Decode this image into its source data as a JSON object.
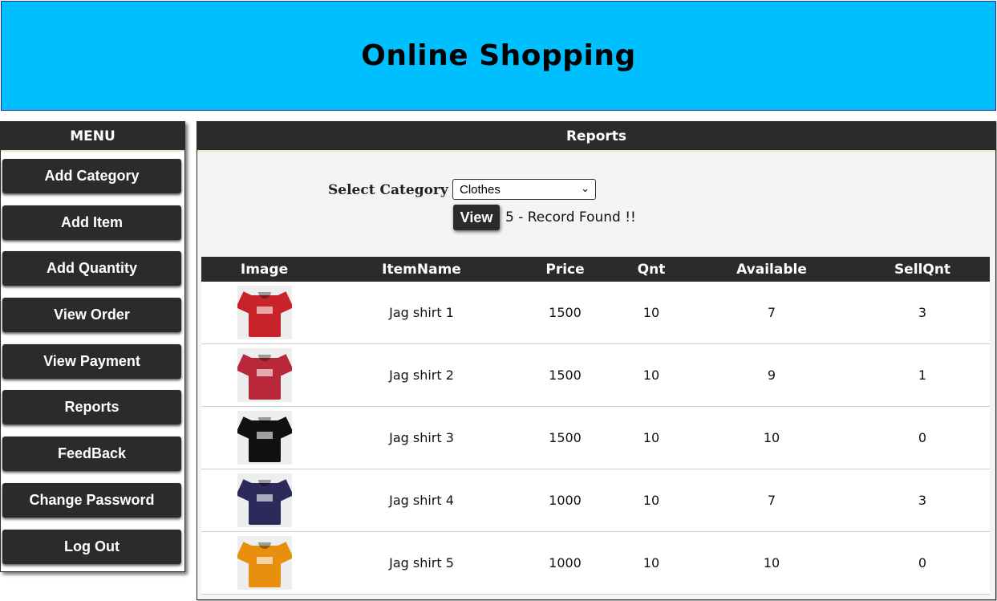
{
  "header": {
    "title": "Online Shopping"
  },
  "sidebar": {
    "title": "MENU",
    "items": [
      "Add Category",
      "Add Item",
      "Add Quantity",
      "View Order",
      "View Payment",
      "Reports",
      "FeedBack",
      "Change Password",
      "Log Out"
    ]
  },
  "main": {
    "title": "Reports",
    "filter": {
      "label": "Select Category :",
      "selected": "Clothes",
      "view_label": "View",
      "record_text": "5 - Record Found !!"
    },
    "table": {
      "columns": [
        "Image",
        "ItemName",
        "Price",
        "Qnt",
        "Available",
        "SellQnt"
      ],
      "rows": [
        {
          "image": "red-shirt-image",
          "color": "#c8222a",
          "item": "Jag shirt 1",
          "price": "1500",
          "qnt": "10",
          "available": "7",
          "sell": "3"
        },
        {
          "image": "crimson-shirt-image",
          "color": "#b8283a",
          "item": "Jag shirt 2",
          "price": "1500",
          "qnt": "10",
          "available": "9",
          "sell": "1"
        },
        {
          "image": "black-shirt-image",
          "color": "#111111",
          "item": "Jag shirt 3",
          "price": "1500",
          "qnt": "10",
          "available": "10",
          "sell": "0"
        },
        {
          "image": "navy-shirt-image",
          "color": "#2c2a5a",
          "item": "Jag shirt 4",
          "price": "1000",
          "qnt": "10",
          "available": "7",
          "sell": "3"
        },
        {
          "image": "orange-shirt-image",
          "color": "#e8900e",
          "item": "Jag shirt 5",
          "price": "1000",
          "qnt": "10",
          "available": "10",
          "sell": "0"
        }
      ]
    }
  },
  "colors": {
    "header_bg": "#00bfff",
    "dark": "#2b2b2b"
  }
}
